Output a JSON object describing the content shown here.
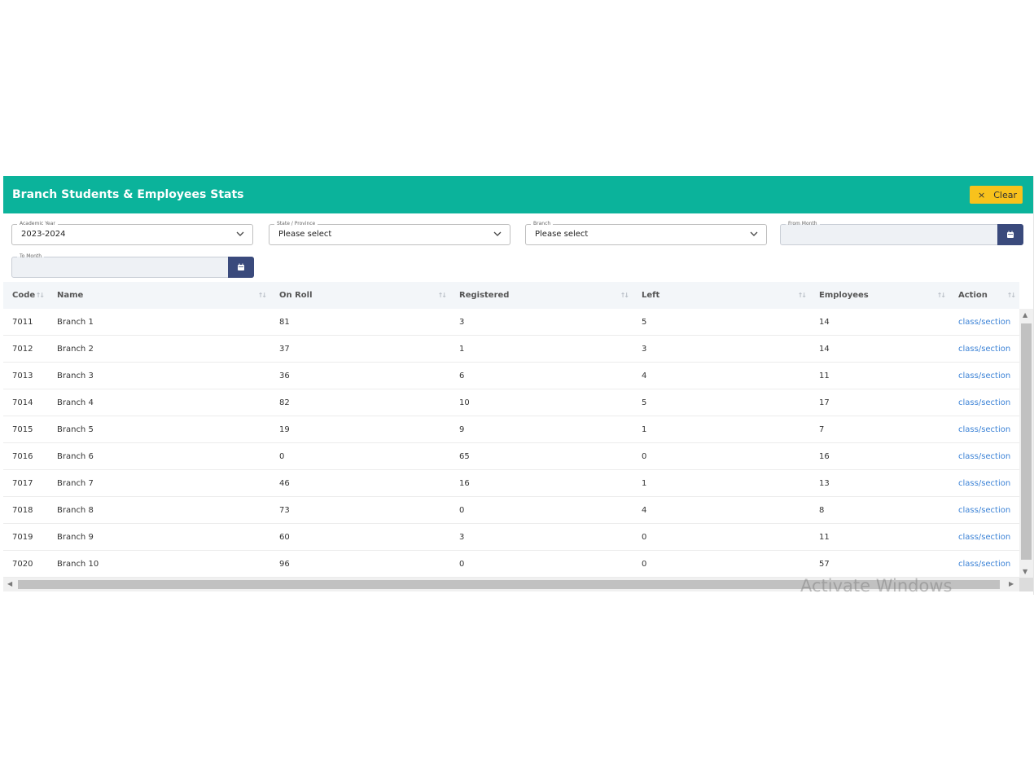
{
  "header": {
    "title": "Branch Students & Employees Stats",
    "clear_icon": "×",
    "clear_label": "Clear",
    "color": "#0bb39b",
    "clear_color": "#f8c21c"
  },
  "filters": {
    "academic_year": {
      "label": "Academic Year",
      "value": "2023-2024"
    },
    "state": {
      "label": "State / Province",
      "value": "Please select"
    },
    "branch": {
      "label": "Branch",
      "value": "Please select"
    },
    "from_month": {
      "label": "From Month",
      "value": ""
    },
    "to_month": {
      "label": "To Month",
      "value": ""
    },
    "calendar_icon": "calendar-icon"
  },
  "table": {
    "columns": [
      "Code",
      "Name",
      "On Roll",
      "Registered",
      "Left",
      "Employees",
      "Action"
    ],
    "rows": [
      {
        "code": "7011",
        "name": "Branch 1",
        "on_roll": "81",
        "registered": "3",
        "left": "5",
        "employees": "14",
        "action": "class/section"
      },
      {
        "code": "7012",
        "name": "Branch 2",
        "on_roll": "37",
        "registered": "1",
        "left": "3",
        "employees": "14",
        "action": "class/section"
      },
      {
        "code": "7013",
        "name": "Branch 3",
        "on_roll": "36",
        "registered": "6",
        "left": "4",
        "employees": "11",
        "action": "class/section"
      },
      {
        "code": "7014",
        "name": "Branch 4",
        "on_roll": "82",
        "registered": "10",
        "left": "5",
        "employees": "17",
        "action": "class/section"
      },
      {
        "code": "7015",
        "name": "Branch 5",
        "on_roll": "19",
        "registered": "9",
        "left": "1",
        "employees": "7",
        "action": "class/section"
      },
      {
        "code": "7016",
        "name": "Branch 6",
        "on_roll": "0",
        "registered": "65",
        "left": "0",
        "employees": "16",
        "action": "class/section"
      },
      {
        "code": "7017",
        "name": "Branch 7",
        "on_roll": "46",
        "registered": "16",
        "left": "1",
        "employees": "13",
        "action": "class/section"
      },
      {
        "code": "7018",
        "name": "Branch 8",
        "on_roll": "73",
        "registered": "0",
        "left": "4",
        "employees": "8",
        "action": "class/section"
      },
      {
        "code": "7019",
        "name": "Branch 9",
        "on_roll": "60",
        "registered": "3",
        "left": "0",
        "employees": "11",
        "action": "class/section"
      },
      {
        "code": "7020",
        "name": "Branch 10",
        "on_roll": "96",
        "registered": "0",
        "left": "0",
        "employees": "57",
        "action": "class/section"
      }
    ]
  },
  "watermark": "Activate Windows"
}
